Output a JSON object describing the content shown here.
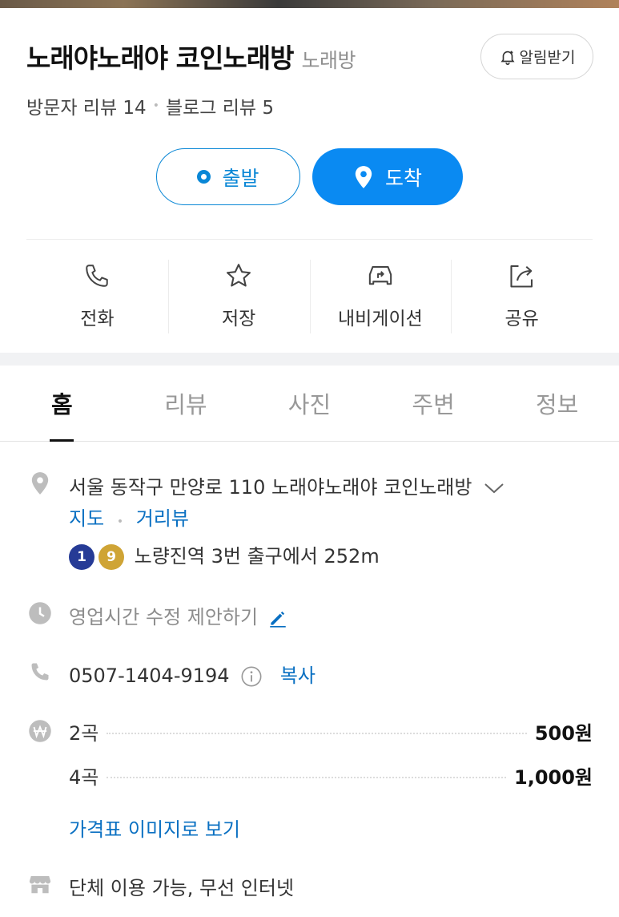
{
  "place": {
    "name": "노래야노래야 코인노래방",
    "category": "노래방",
    "alarm_label": "알림받기",
    "visitor_reviews": "방문자 리뷰 14",
    "blog_reviews": "블로그 리뷰 5",
    "separator": "•"
  },
  "route": {
    "start_label": "출발",
    "arrive_label": "도착"
  },
  "actions": [
    {
      "label": "전화",
      "icon": "phone-icon"
    },
    {
      "label": "저장",
      "icon": "star-icon"
    },
    {
      "label": "내비게이션",
      "icon": "car-navigation-icon"
    },
    {
      "label": "공유",
      "icon": "share-icon"
    }
  ],
  "tabs": [
    {
      "label": "홈",
      "active": true
    },
    {
      "label": "리뷰",
      "active": false
    },
    {
      "label": "사진",
      "active": false
    },
    {
      "label": "주변",
      "active": false
    },
    {
      "label": "정보",
      "active": false
    }
  ],
  "info": {
    "address": "서울 동작구 만양로 110 노래야노래야 코인노래방",
    "map_link": "지도",
    "street_view_link": "거리뷰",
    "subway_lines": [
      "1",
      "9"
    ],
    "subway_text": "노량진역 3번 출구에서 252m",
    "hours_text": "영업시간 수정 제안하기",
    "phone": "0507-1404-9194",
    "copy_label": "복사",
    "prices": [
      {
        "item": "2곡",
        "price": "500원"
      },
      {
        "item": "4곡",
        "price": "1,000원"
      }
    ],
    "price_image_link": "가격표 이미지로 보기",
    "facilities": "단체 이용 가능, 무선 인터넷"
  },
  "colors": {
    "accent_blue": "#0a8af2",
    "link_blue": "#0a70c2",
    "line1": "#263b96",
    "line9": "#cfa435"
  }
}
